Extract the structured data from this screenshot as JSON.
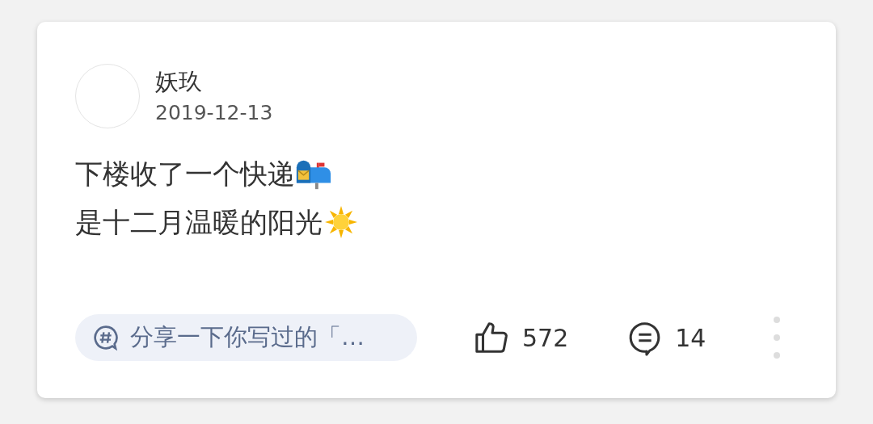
{
  "post": {
    "author": "妖玖",
    "date": "2019-12-13",
    "lines": [
      {
        "text": "下楼收了一个快递",
        "kind": "mailbox"
      },
      {
        "text": "是十二月温暖的阳光",
        "kind": "sun"
      }
    ],
    "topic": "分享一下你写过的「…",
    "likes": "572",
    "comments": "14"
  }
}
